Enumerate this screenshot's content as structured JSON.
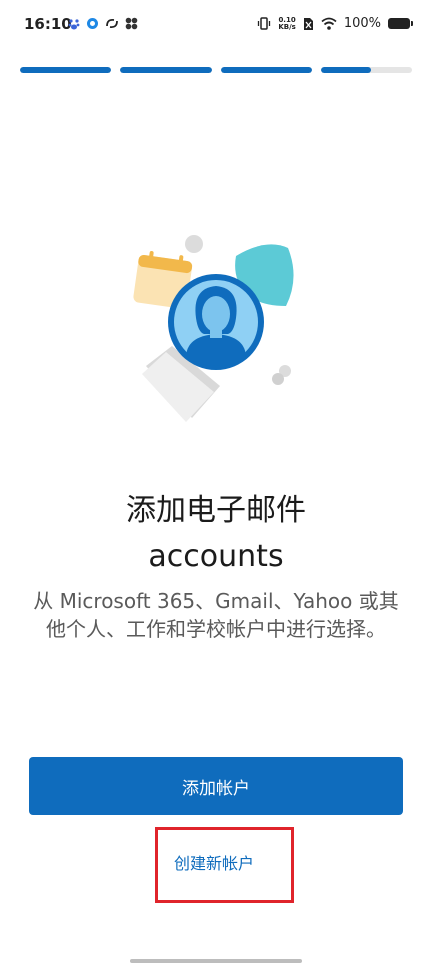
{
  "status_bar": {
    "time": "16:10",
    "netspeed_value": "0.10",
    "netspeed_unit": "KB/s",
    "battery": "100%",
    "icons_left": [
      "baidu-icon",
      "alarm-icon",
      "sync-icon",
      "app-icon"
    ],
    "icons_right": [
      "vibrate-icon",
      "netspeed-icon",
      "sim-off-icon",
      "wifi-icon",
      "battery-icon"
    ]
  },
  "progress": {
    "segments": [
      1,
      1,
      1,
      0.55
    ],
    "accent": "#0f6cbd"
  },
  "illustration": {
    "icon": "email-accounts-illustration",
    "elements": [
      "calendar-icon",
      "person-avatar-icon",
      "shield-icon",
      "document-icon"
    ]
  },
  "content": {
    "title_line1": "添加电子邮件",
    "title_line2": "accounts",
    "description": "从 Microsoft 365、Gmail、Yahoo 或其他个人、工作和学校帐户中进行选择。"
  },
  "actions": {
    "add_account_label": "添加帐户",
    "create_account_label": "创建新帐户"
  },
  "colors": {
    "primary": "#0f6cbd",
    "highlight": "#e0242b"
  }
}
